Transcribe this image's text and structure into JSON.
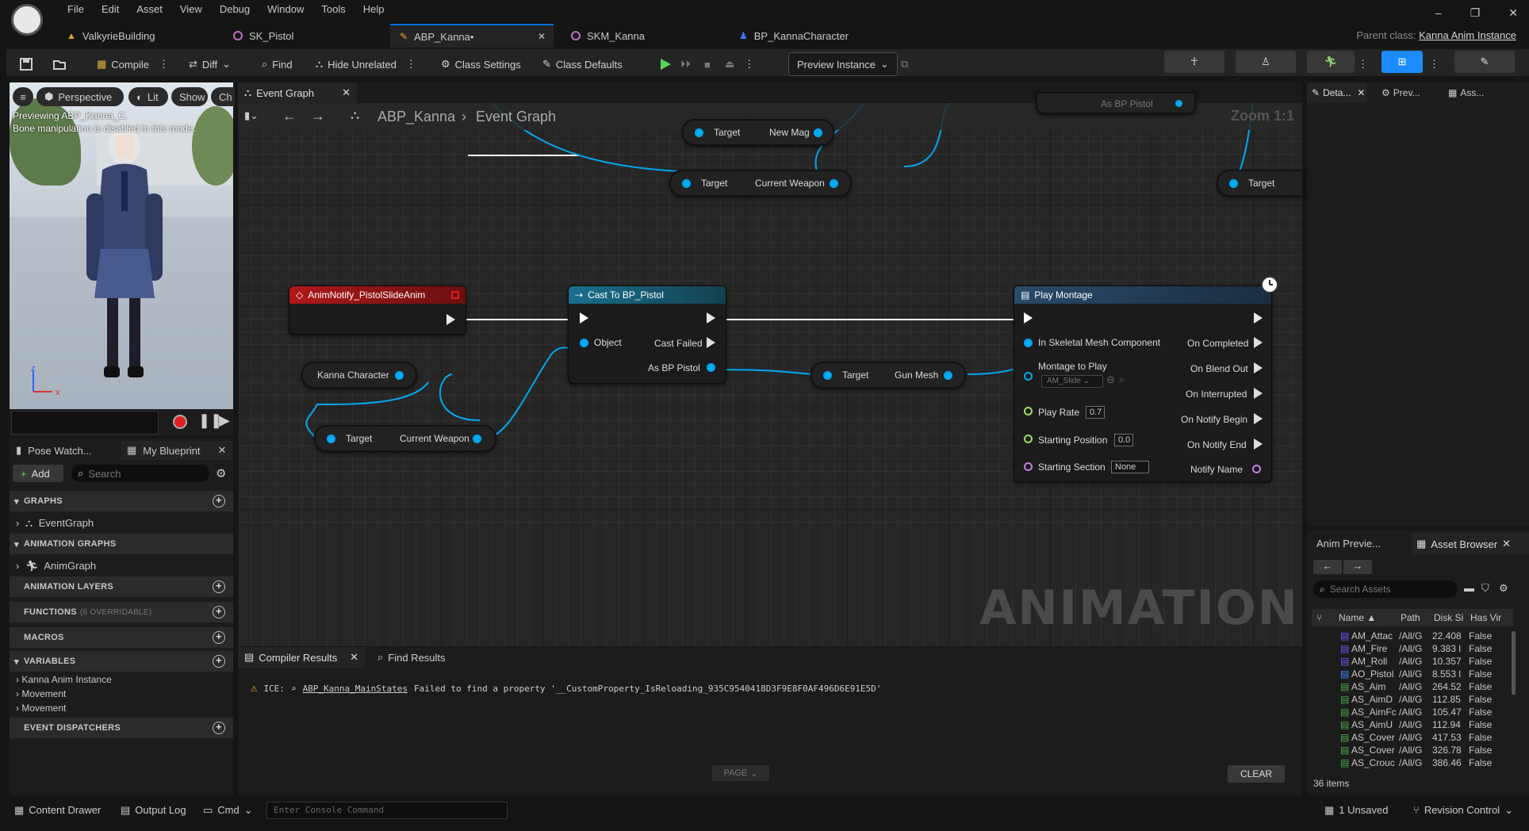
{
  "menu": [
    "File",
    "Edit",
    "Asset",
    "View",
    "Debug",
    "Window",
    "Tools",
    "Help"
  ],
  "tabs": [
    {
      "label": "ValkyrieBuilding",
      "color": "#e0a030"
    },
    {
      "label": "SK_Pistol",
      "color": "#c070c0"
    },
    {
      "label": "ABP_Kanna•",
      "color": "#e0a030"
    },
    {
      "label": "SKM_Kanna",
      "color": "#c070c0"
    },
    {
      "label": "BP_KannaCharacter",
      "color": "#3d7aff"
    }
  ],
  "parent_class": {
    "label": "Parent class:",
    "value": "Kanna Anim Instance"
  },
  "toolbar": {
    "compile": "Compile",
    "diff": "Diff",
    "find": "Find",
    "hide_unrelated": "Hide Unrelated",
    "class_settings": "Class Settings",
    "class_defaults": "Class Defaults",
    "preview_instance": "Preview Instance"
  },
  "viewport": {
    "perspective": "Perspective",
    "lit": "Lit",
    "show": "Show",
    "ch": "Ch",
    "msg1": "Previewing ABP_Kanna_C.",
    "msg2": "Bone manipulation is disabled in this mode."
  },
  "left_tabs": {
    "pose_watch": "Pose Watch...",
    "my_blueprint": "My Blueprint"
  },
  "my_blueprint": {
    "add": "Add",
    "search_placeholder": "Search",
    "graphs": "GRAPHS",
    "event_graph": "EventGraph",
    "animation_graphs": "ANIMATION GRAPHS",
    "anim_graph": "AnimGraph",
    "animation_layers": "ANIMATION LAYERS",
    "functions": "FUNCTIONS",
    "functions_note": "(6 OVERRIDABLE)",
    "macros": "MACROS",
    "variables": "VARIABLES",
    "vars": [
      "Kanna Anim Instance",
      "Movement",
      "Movement"
    ],
    "event_dispatchers": "EVENT DISPATCHERS"
  },
  "graph": {
    "tab": "Event Graph",
    "crumb_root": "ABP_Kanna",
    "crumb_leaf": "Event Graph",
    "zoom": "Zoom 1:1",
    "watermark": "ANIMATION",
    "n_target_newmag": {
      "a": "Target",
      "b": "New Mag"
    },
    "n_target_weapon_top": {
      "a": "Target",
      "b": "Current Weapon"
    },
    "n_target_right": "Target",
    "n_as_bp_pistol_top": "As BP Pistol",
    "n_anim_notify": "AnimNotify_PistolSlideAnim",
    "n_kanna_char": "Kanna Character",
    "n_target_weapon": {
      "a": "Target",
      "b": "Current Weapon"
    },
    "n_cast": {
      "title": "Cast To BP_Pistol",
      "object": "Object",
      "failed": "Cast Failed",
      "as": "As BP Pistol"
    },
    "n_gun_mesh": {
      "a": "Target",
      "b": "Gun Mesh"
    },
    "n_play": {
      "title": "Play Montage",
      "skel": "In Skeletal Mesh Component",
      "montage": "Montage to Play",
      "montage_val": "AM_Slide",
      "rate": "Play Rate",
      "rate_val": "0.7",
      "start_pos": "Starting Position",
      "start_pos_val": "0.0",
      "start_sec": "Starting Section",
      "start_sec_val": "None",
      "on_completed": "On Completed",
      "on_blend_out": "On Blend Out",
      "on_interrupted": "On Interrupted",
      "on_notify_begin": "On Notify Begin",
      "on_notify_end": "On Notify End",
      "notify_name": "Notify Name"
    }
  },
  "compiler": {
    "tab1": "Compiler Results",
    "tab2": "Find Results",
    "msg_prefix": "ICE:",
    "msg_link": "ABP_Kanna_MainStates",
    "msg_text": "Failed to find a property '__CustomProperty_IsReloading_935C9540418D3F9E8F0AF496D6E91E5D'",
    "page": "PAGE",
    "clear": "CLEAR"
  },
  "right_tabs": {
    "details": "Deta...",
    "preview": "Prev...",
    "asset": "Ass..."
  },
  "asset_browser": {
    "tab1": "Anim Previe...",
    "tab2": "Asset Browser",
    "search_placeholder": "Search Assets",
    "cols": [
      "Name",
      "Path",
      "Disk Si",
      "Has Vir"
    ],
    "rows": [
      [
        "AM_Attac",
        "/All/G",
        "22.408",
        "False"
      ],
      [
        "AM_Fire",
        "/All/G",
        "9.383 l",
        "False"
      ],
      [
        "AM_Roll",
        "/All/G",
        "10.357",
        "False"
      ],
      [
        "AO_Pistol",
        "/All/G",
        "8.553 l",
        "False"
      ],
      [
        "AS_Aim",
        "/All/G",
        "264.52",
        "False"
      ],
      [
        "AS_AimD",
        "/All/G",
        "112.85",
        "False"
      ],
      [
        "AS_AimFc",
        "/All/G",
        "105.47",
        "False"
      ],
      [
        "AS_AimU",
        "/All/G",
        "112.94",
        "False"
      ],
      [
        "AS_Cover",
        "/All/G",
        "417.53",
        "False"
      ],
      [
        "AS_Cover",
        "/All/G",
        "326.78",
        "False"
      ],
      [
        "AS_Crouc",
        "/All/G",
        "386.46",
        "False"
      ]
    ],
    "count": "36 items"
  },
  "status": {
    "content_drawer": "Content Drawer",
    "output_log": "Output Log",
    "cmd": "Cmd",
    "console_placeholder": "Enter Console Command",
    "unsaved": "1 Unsaved",
    "revision": "Revision Control"
  }
}
